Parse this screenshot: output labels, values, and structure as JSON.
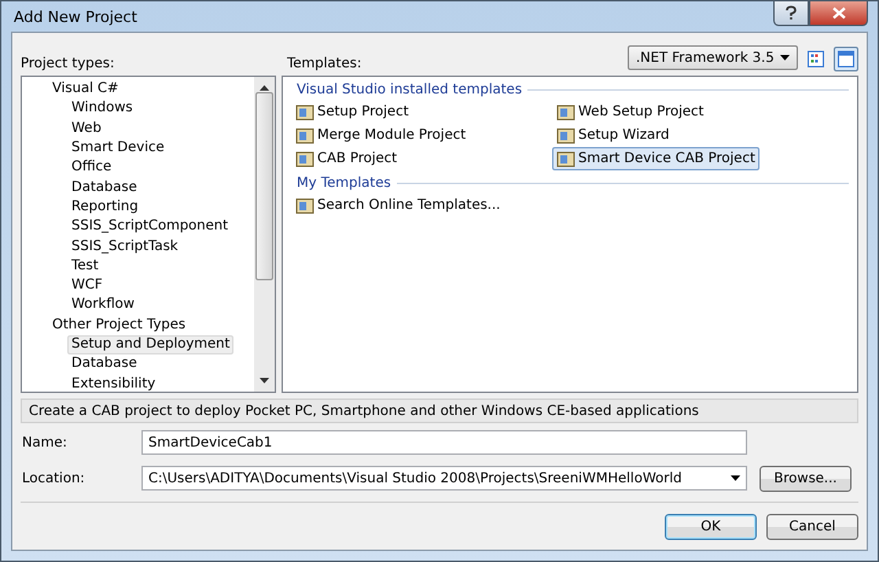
{
  "window": {
    "title": "Add New Project"
  },
  "project_types": {
    "label": "Project types:",
    "items": [
      {
        "label": "Visual C#",
        "selected": false,
        "children": [
          {
            "label": "Windows",
            "selected": false
          },
          {
            "label": "Web",
            "selected": false
          },
          {
            "label": "Smart Device",
            "selected": false
          },
          {
            "label": "Office",
            "selected": false
          },
          {
            "label": "Database",
            "selected": false
          },
          {
            "label": "Reporting",
            "selected": false
          },
          {
            "label": "SSIS_ScriptComponent",
            "selected": false
          },
          {
            "label": "SSIS_ScriptTask",
            "selected": false
          },
          {
            "label": "Test",
            "selected": false
          },
          {
            "label": "WCF",
            "selected": false
          },
          {
            "label": "Workflow",
            "selected": false
          }
        ]
      },
      {
        "label": "Other Project Types",
        "selected": false,
        "children": [
          {
            "label": "Setup and Deployment",
            "selected": true
          },
          {
            "label": "Database",
            "selected": false
          },
          {
            "label": "Extensibility",
            "selected": false
          }
        ]
      }
    ]
  },
  "templates": {
    "label": "Templates:",
    "framework": ".NET Framework 3.5",
    "groups": [
      {
        "title": "Visual Studio installed templates",
        "items": [
          {
            "label": "Setup Project",
            "selected": false
          },
          {
            "label": "Web Setup Project",
            "selected": false
          },
          {
            "label": "Merge Module Project",
            "selected": false
          },
          {
            "label": "Setup Wizard",
            "selected": false
          },
          {
            "label": "CAB Project",
            "selected": false
          },
          {
            "label": "Smart Device CAB Project",
            "selected": true
          }
        ]
      },
      {
        "title": "My Templates",
        "items": [
          {
            "label": "Search Online Templates...",
            "selected": false
          }
        ]
      }
    ]
  },
  "description": "Create a CAB project to deploy Pocket PC, Smartphone and other Windows CE-based applications",
  "name": {
    "label": "Name:",
    "value": "SmartDeviceCab1"
  },
  "location": {
    "label": "Location:",
    "value": "C:\\Users\\ADITYA\\Documents\\Visual Studio 2008\\Projects\\SreeniWMHelloWorld",
    "button": "Browse..."
  },
  "buttons": [
    "OK",
    "Cancel"
  ]
}
